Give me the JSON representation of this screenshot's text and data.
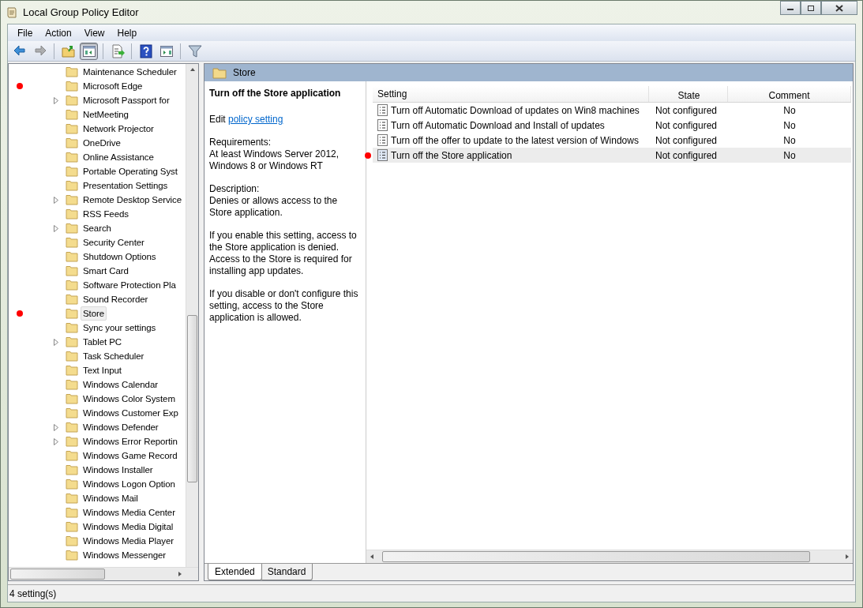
{
  "window": {
    "title": "Local Group Policy Editor"
  },
  "menu": [
    "File",
    "Action",
    "View",
    "Help"
  ],
  "toolbar": [
    {
      "kind": "back",
      "disabled": false,
      "pressed": false
    },
    {
      "kind": "forward",
      "disabled": true,
      "pressed": false
    },
    {
      "kind": "separator"
    },
    {
      "kind": "up",
      "disabled": false,
      "pressed": false
    },
    {
      "kind": "tree",
      "disabled": false,
      "pressed": true
    },
    {
      "kind": "separator"
    },
    {
      "kind": "export",
      "disabled": false,
      "pressed": false
    },
    {
      "kind": "separator"
    },
    {
      "kind": "help",
      "disabled": false,
      "pressed": false
    },
    {
      "kind": "pane",
      "disabled": false,
      "pressed": false
    },
    {
      "kind": "separator"
    },
    {
      "kind": "filter",
      "disabled": false,
      "pressed": false
    }
  ],
  "tree": {
    "items": [
      {
        "label": "Maintenance Scheduler",
        "expandable": false,
        "selected": false,
        "annotated": false
      },
      {
        "label": "Microsoft Edge",
        "expandable": false,
        "selected": false,
        "annotated": true
      },
      {
        "label": "Microsoft Passport for",
        "expandable": true,
        "selected": false,
        "annotated": false
      },
      {
        "label": "NetMeeting",
        "expandable": false,
        "selected": false,
        "annotated": false
      },
      {
        "label": "Network Projector",
        "expandable": false,
        "selected": false,
        "annotated": false
      },
      {
        "label": "OneDrive",
        "expandable": false,
        "selected": false,
        "annotated": false
      },
      {
        "label": "Online Assistance",
        "expandable": false,
        "selected": false,
        "annotated": false
      },
      {
        "label": "Portable Operating Syst",
        "expandable": false,
        "selected": false,
        "annotated": false
      },
      {
        "label": "Presentation Settings",
        "expandable": false,
        "selected": false,
        "annotated": false
      },
      {
        "label": "Remote Desktop Service",
        "expandable": true,
        "selected": false,
        "annotated": false
      },
      {
        "label": "RSS Feeds",
        "expandable": false,
        "selected": false,
        "annotated": false
      },
      {
        "label": "Search",
        "expandable": true,
        "selected": false,
        "annotated": false
      },
      {
        "label": "Security Center",
        "expandable": false,
        "selected": false,
        "annotated": false
      },
      {
        "label": "Shutdown Options",
        "expandable": false,
        "selected": false,
        "annotated": false
      },
      {
        "label": "Smart Card",
        "expandable": false,
        "selected": false,
        "annotated": false
      },
      {
        "label": "Software Protection Pla",
        "expandable": false,
        "selected": false,
        "annotated": false
      },
      {
        "label": "Sound Recorder",
        "expandable": false,
        "selected": false,
        "annotated": false
      },
      {
        "label": "Store",
        "expandable": false,
        "selected": true,
        "annotated": true
      },
      {
        "label": "Sync your settings",
        "expandable": false,
        "selected": false,
        "annotated": false
      },
      {
        "label": "Tablet PC",
        "expandable": true,
        "selected": false,
        "annotated": false
      },
      {
        "label": "Task Scheduler",
        "expandable": false,
        "selected": false,
        "annotated": false
      },
      {
        "label": "Text Input",
        "expandable": false,
        "selected": false,
        "annotated": false
      },
      {
        "label": "Windows Calendar",
        "expandable": false,
        "selected": false,
        "annotated": false
      },
      {
        "label": "Windows Color System",
        "expandable": false,
        "selected": false,
        "annotated": false
      },
      {
        "label": "Windows Customer Exp",
        "expandable": false,
        "selected": false,
        "annotated": false
      },
      {
        "label": "Windows Defender",
        "expandable": true,
        "selected": false,
        "annotated": false
      },
      {
        "label": "Windows Error Reportin",
        "expandable": true,
        "selected": false,
        "annotated": false
      },
      {
        "label": "Windows Game Record",
        "expandable": false,
        "selected": false,
        "annotated": false
      },
      {
        "label": "Windows Installer",
        "expandable": false,
        "selected": false,
        "annotated": false
      },
      {
        "label": "Windows Logon Option",
        "expandable": false,
        "selected": false,
        "annotated": false
      },
      {
        "label": "Windows Mail",
        "expandable": false,
        "selected": false,
        "annotated": false
      },
      {
        "label": "Windows Media Center",
        "expandable": false,
        "selected": false,
        "annotated": false
      },
      {
        "label": "Windows Media Digital",
        "expandable": false,
        "selected": false,
        "annotated": false
      },
      {
        "label": "Windows Media Player",
        "expandable": false,
        "selected": false,
        "annotated": false
      },
      {
        "label": "Windows Messenger",
        "expandable": false,
        "selected": false,
        "annotated": false
      }
    ]
  },
  "details": {
    "header": "Store",
    "title": "Turn off the Store application",
    "edit_prefix": "Edit",
    "edit_link": "policy setting",
    "paragraphs": [
      "Requirements:\nAt least Windows Server 2012, Windows 8 or Windows RT",
      "Description:\nDenies or allows access to the Store application.",
      "If you enable this setting, access to the Store application is denied. Access to the Store is required for installing app updates.",
      "If you disable or don't configure this setting, access to the Store application is allowed."
    ]
  },
  "table": {
    "columns": [
      "Setting",
      "State",
      "Comment"
    ],
    "rows": [
      {
        "setting": "Turn off Automatic Download of updates on Win8 machines",
        "state": "Not configured",
        "comment": "No",
        "selected": false,
        "annotated": false
      },
      {
        "setting": "Turn off Automatic Download and Install of updates",
        "state": "Not configured",
        "comment": "No",
        "selected": false,
        "annotated": false
      },
      {
        "setting": "Turn off the offer to update to the latest version of Windows",
        "state": "Not configured",
        "comment": "No",
        "selected": false,
        "annotated": false
      },
      {
        "setting": "Turn off the Store application",
        "state": "Not configured",
        "comment": "No",
        "selected": true,
        "annotated": true
      }
    ]
  },
  "tabs": [
    {
      "label": "Extended",
      "selected": true
    },
    {
      "label": "Standard",
      "selected": false
    }
  ],
  "status_bar": "4 setting(s)"
}
